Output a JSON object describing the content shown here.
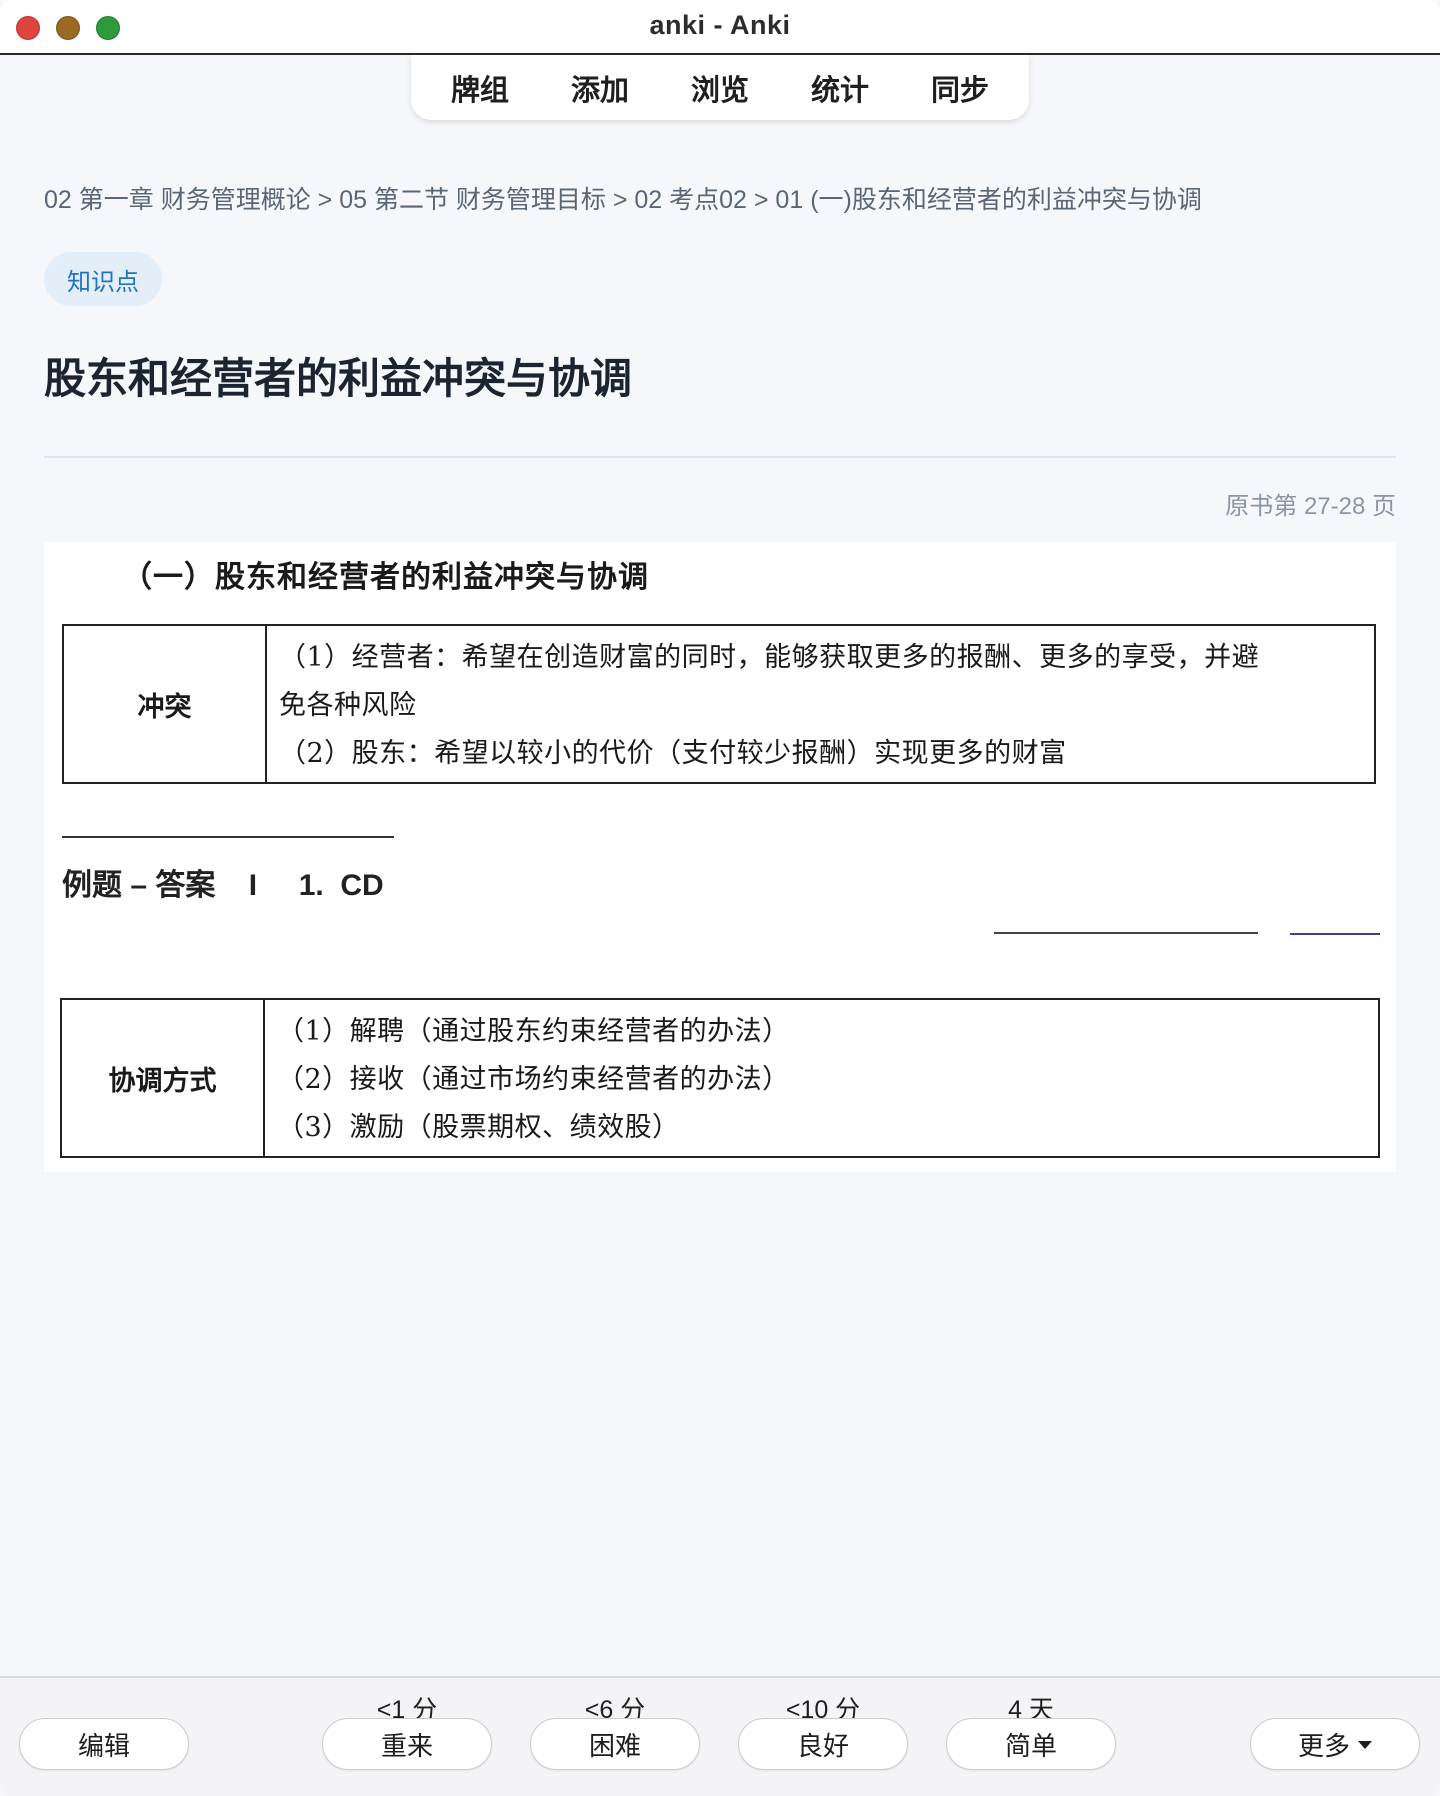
{
  "window": {
    "title": "anki - Anki"
  },
  "topnav": {
    "items": [
      "牌组",
      "添加",
      "浏览",
      "统计",
      "同步"
    ]
  },
  "card": {
    "breadcrumb": "02 第一章 财务管理概论 > 05 第二节 财务管理目标 > 02 考点02 > 01 (一)股东和经营者的利益冲突与协调",
    "tag": "知识点",
    "title": "股东和经营者的利益冲突与协调",
    "page_ref": "原书第 27-28 页"
  },
  "scan": {
    "heading": "（一）股东和经营者的利益冲突与协调",
    "conflict_table": {
      "label": "冲突",
      "lines": [
        "（1）经营者：希望在创造财富的同时，能够获取更多的报酬、更多的享受，并避",
        "免各种风险",
        "（2）股东：希望以较小的代价（支付较少报酬）实现更多的财富"
      ]
    },
    "answer": "例题 – 答案    I     1.  CD",
    "coord_table": {
      "label": "协调方式",
      "lines": [
        "（1）解聘（通过股东约束经营者的办法）",
        "（2）接收（通过市场约束经营者的办法）",
        "（3）激励（股票期权、绩效股）"
      ]
    }
  },
  "answer_bar": {
    "edit_label": "编辑",
    "more_label": "更多",
    "buttons": [
      {
        "interval": "<1 分",
        "label": "重来"
      },
      {
        "interval": "<6 分",
        "label": "困难"
      },
      {
        "interval": "<10 分",
        "label": "良好"
      },
      {
        "interval": "4 天",
        "label": "简单"
      }
    ]
  }
}
